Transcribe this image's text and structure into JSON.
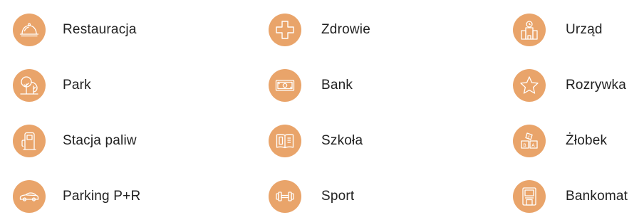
{
  "theme": {
    "icon_bg": "#E9A46A",
    "icon_stroke": "#ffffff",
    "text_color": "#222222"
  },
  "poi": [
    {
      "label": "Restauracja",
      "icon": "cloche-icon"
    },
    {
      "label": "Zdrowie",
      "icon": "health-cross-icon"
    },
    {
      "label": "Urząd",
      "icon": "city-hall-icon"
    },
    {
      "label": "Park",
      "icon": "trees-icon"
    },
    {
      "label": "Bank",
      "icon": "banknote-icon"
    },
    {
      "label": "Rozrywka",
      "icon": "star-icon"
    },
    {
      "label": "Stacja paliw",
      "icon": "fuel-pump-icon"
    },
    {
      "label": "Szkoła",
      "icon": "open-book-icon"
    },
    {
      "label": "Żłobek",
      "icon": "toy-blocks-icon"
    },
    {
      "label": "Parking P+R",
      "icon": "car-icon"
    },
    {
      "label": "Sport",
      "icon": "dumbbell-icon"
    },
    {
      "label": "Bankomat",
      "icon": "atm-icon"
    }
  ]
}
